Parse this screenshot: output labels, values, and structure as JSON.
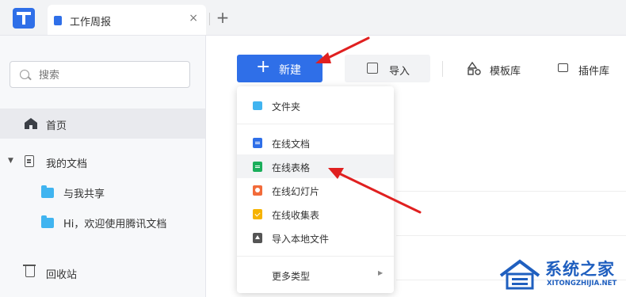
{
  "tab": {
    "title": "工作周报",
    "close": "×",
    "add": "+"
  },
  "sidebar": {
    "search_placeholder": "搜索",
    "items": [
      {
        "label": "首页"
      },
      {
        "label": "我的文档"
      },
      {
        "label": "与我共享"
      },
      {
        "label": "Hi，欢迎使用腾讯文档"
      },
      {
        "label": "回收站"
      }
    ]
  },
  "toolbar": {
    "new_label": "新建",
    "import_label": "导入",
    "template_label": "模板库",
    "plugin_label": "插件库"
  },
  "menu": {
    "items": [
      {
        "label": "文件夹"
      },
      {
        "label": "在线文档"
      },
      {
        "label": "在线表格"
      },
      {
        "label": "在线幻灯片"
      },
      {
        "label": "在线收集表"
      },
      {
        "label": "导入本地文件"
      },
      {
        "label": "更多类型"
      }
    ]
  },
  "watermark": {
    "title": "系统之家",
    "subtitle": "XITONGZHIJIA.NET"
  },
  "colors": {
    "accent": "#2f6fe8",
    "annotation": "#e02020"
  }
}
